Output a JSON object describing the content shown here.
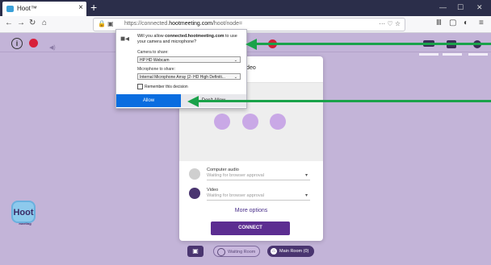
{
  "browser": {
    "tab_title": "Hoot™",
    "tab_close": "×",
    "new_tab": "+",
    "window_controls": [
      "—",
      "☐",
      "✕"
    ],
    "url_prefix": "https://connected.",
    "url_domain": "hootmeeting.com",
    "url_suffix": "/hoot/node=",
    "url_menu": "··· ♡ ☆"
  },
  "permission_prompt": {
    "question_prefix": "Will you allow ",
    "question_domain": "connected.hootmeeting.com",
    "question_suffix": " to use your camera and microphone?",
    "camera_label": "Camera to share:",
    "camera_value": "HP HD Webcam",
    "microphone_label": "Microphone to share:",
    "microphone_value": "Internal Microphone Array (2- HD High Definiti...",
    "remember_label": "Remember this decision",
    "allow_label": "Allow",
    "dont_allow_label": "Don't Allow"
  },
  "dialog": {
    "title": "video",
    "audio_title": "Computer audio",
    "audio_status": "Waiting for browser approval",
    "video_title": "Video",
    "video_status": "Waiting for browser approval",
    "more_options": "More options",
    "connect_label": "CONNECT"
  },
  "bottom_bar": {
    "logo_text": "Hoot",
    "logo_sub": "meeting",
    "waiting_room": "Waiting Room",
    "main_room": "Main Room (0)"
  },
  "colors": {
    "app_bg": "#c3b4d8",
    "accent_purple": "#5c2d91",
    "allow_blue": "#0a6de0",
    "annotation_green": "#1aa24a",
    "record_red": "#d8203a"
  }
}
